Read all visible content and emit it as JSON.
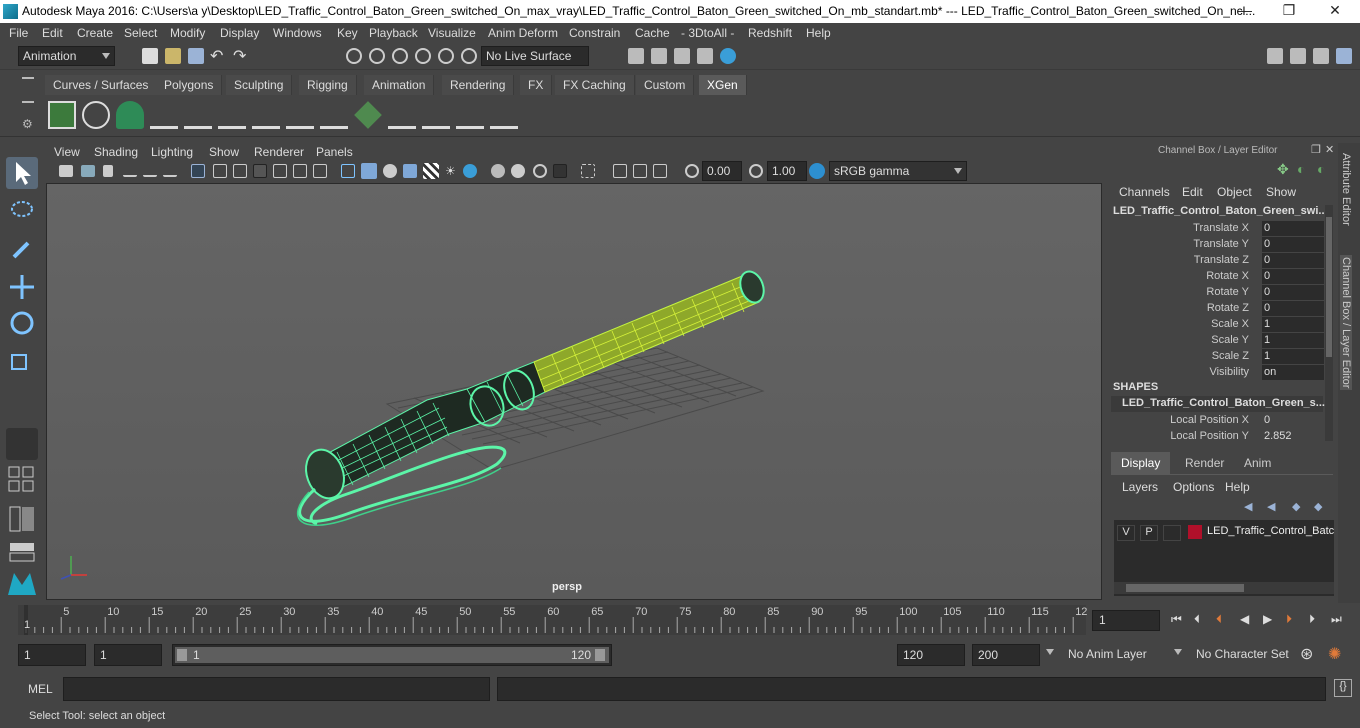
{
  "window": {
    "title": "Autodesk Maya 2016: C:\\Users\\a y\\Desktop\\LED_Traffic_Control_Baton_Green_switched_On_max_vray\\LED_Traffic_Control_Baton_Green_switched_On_mb_standart.mb*   ---   LED_Traffic_Control_Baton_Green_switched_On_ncl...",
    "minimize": "—",
    "maximize": "❐",
    "close": "✕"
  },
  "menubar": [
    "File",
    "Edit",
    "Create",
    "Select",
    "Modify",
    "Display",
    "Windows",
    "Key",
    "Playback",
    "Visualize",
    "Anim Deform",
    "Constrain",
    "Cache",
    "- 3DtoAll -",
    "Redshift",
    "Help"
  ],
  "statusline": {
    "mode": "Animation",
    "live_surface": "No Live Surface"
  },
  "shelf_tabs": [
    "Curves / Surfaces",
    "Polygons",
    "Sculpting",
    "Rigging",
    "Animation",
    "Rendering",
    "FX",
    "FX Caching",
    "Custom",
    "XGen"
  ],
  "active_shelf_tab": "XGen",
  "viewport": {
    "menu": [
      "View",
      "Shading",
      "Lighting",
      "Show",
      "Renderer",
      "Panels"
    ],
    "exposure": "0.00",
    "gamma": "1.00",
    "color_space": "sRGB gamma",
    "camera_label": "persp",
    "colors": {
      "wire": "#5cf5a8",
      "glow": "#d6f23a",
      "bg": "#5e5e5e"
    }
  },
  "channel_box": {
    "header": "Channel Box / Layer Editor",
    "menu": [
      "Channels",
      "Edit",
      "Object",
      "Show"
    ],
    "object_name": "LED_Traffic_Control_Baton_Green_swi...",
    "attributes": [
      {
        "label": "Translate X",
        "value": "0"
      },
      {
        "label": "Translate Y",
        "value": "0"
      },
      {
        "label": "Translate Z",
        "value": "0"
      },
      {
        "label": "Rotate X",
        "value": "0"
      },
      {
        "label": "Rotate Y",
        "value": "0"
      },
      {
        "label": "Rotate Z",
        "value": "0"
      },
      {
        "label": "Scale X",
        "value": "1"
      },
      {
        "label": "Scale Y",
        "value": "1"
      },
      {
        "label": "Scale Z",
        "value": "1"
      },
      {
        "label": "Visibility",
        "value": "on"
      }
    ],
    "shapes_label": "SHAPES",
    "shape_name": "LED_Traffic_Control_Baton_Green_s...",
    "shape_attributes": [
      {
        "label": "Local Position X",
        "value": "0"
      },
      {
        "label": "Local Position Y",
        "value": "2.852"
      }
    ]
  },
  "layer_editor": {
    "tabs": [
      "Display",
      "Render",
      "Anim"
    ],
    "active_tab": "Display",
    "menu": [
      "Layers",
      "Options",
      "Help"
    ],
    "layer": {
      "v": "V",
      "p": "P",
      "name": "LED_Traffic_Control_Batc",
      "color": "#b0102a"
    }
  },
  "side_tabs": [
    "Attribute Editor",
    "Channel Box / Layer Editor"
  ],
  "timeline": {
    "ticks": [
      "5",
      "10",
      "15",
      "20",
      "25",
      "30",
      "35",
      "40",
      "45",
      "50",
      "55",
      "60",
      "65",
      "70",
      "75",
      "80",
      "85",
      "90",
      "95",
      "100",
      "105",
      "110",
      "115",
      "12"
    ],
    "first_label": "1",
    "current_frame": "1"
  },
  "range": {
    "start": "1",
    "start2": "1",
    "slider_start": "1",
    "slider_end": "120",
    "end": "120",
    "end2": "200",
    "anim_layer": "No Anim Layer",
    "character_set": "No Character Set"
  },
  "command_line": {
    "label": "MEL"
  },
  "help_line": "Select Tool: select an object"
}
